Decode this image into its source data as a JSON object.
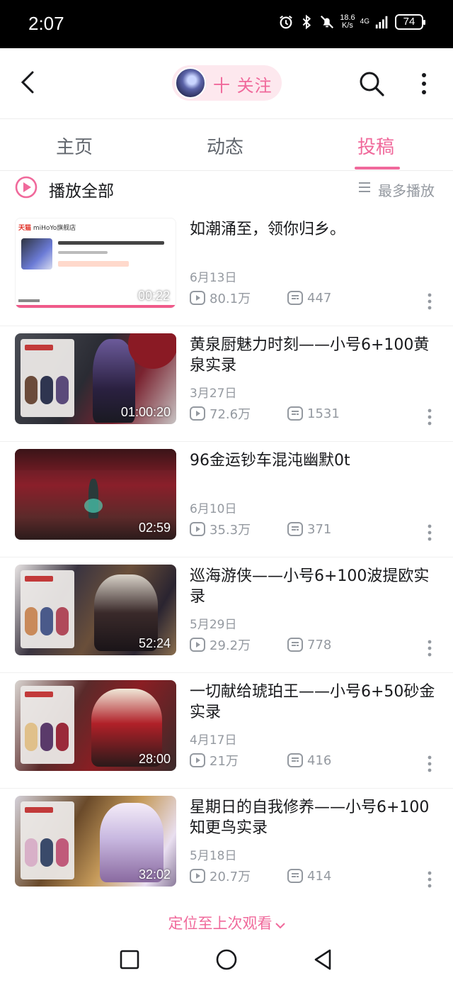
{
  "status_bar": {
    "time": "2:07",
    "net_speed_value": "18.6",
    "net_speed_unit": "K/s",
    "net_type": "4G",
    "battery": "74",
    "icons": [
      "alarm-icon",
      "bluetooth-icon",
      "mute-icon",
      "signal-icon",
      "battery-icon"
    ]
  },
  "top_nav": {
    "follow_label": "十 关注",
    "icons": [
      "back-arrow-icon",
      "avatar",
      "search-icon",
      "more-vertical-icon"
    ]
  },
  "tabs": [
    {
      "label": "主页",
      "active": false
    },
    {
      "label": "动态",
      "active": false
    },
    {
      "label": "投稿",
      "active": true
    }
  ],
  "play_all": {
    "label": "播放全部",
    "sort_label": "最多播放"
  },
  "videos": [
    {
      "title": "如潮涌至，领你归乡。",
      "date": "6月13日",
      "views": "80.1万",
      "comments": "447",
      "duration": "00:22",
      "thumb_text": {
        "store": "天猫",
        "shop": "miHoYo旗舰店"
      }
    },
    {
      "title": "黄泉厨魅力时刻——小号6+100黄泉实录",
      "date": "3月27日",
      "views": "72.6万",
      "comments": "1531",
      "duration": "01:00:20"
    },
    {
      "title": "96金运钞车混沌幽默0t",
      "date": "6月10日",
      "views": "35.3万",
      "comments": "371",
      "duration": "02:59"
    },
    {
      "title": "巡海游侠——小号6+100波提欧实录",
      "date": "5月29日",
      "views": "29.2万",
      "comments": "778",
      "duration": "52:24"
    },
    {
      "title": "一切献给琥珀王——小号6+50砂金实录",
      "date": "4月17日",
      "views": "21万",
      "comments": "416",
      "duration": "28:00"
    },
    {
      "title": "星期日的自我修养——小号6+100知更鸟实录",
      "date": "5月18日",
      "views": "20.7万",
      "comments": "414",
      "duration": "32:02"
    }
  ],
  "relocate_label": "定位至上次观看",
  "colors": {
    "accent": "#f0699b",
    "accent_bg": "#fde8ee",
    "text_primary": "#18191c",
    "text_secondary": "#9499a0"
  }
}
